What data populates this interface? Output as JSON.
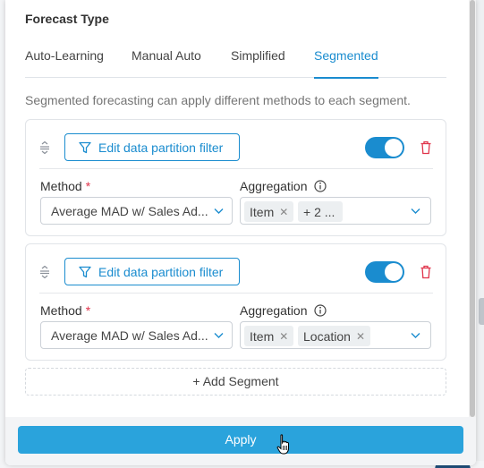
{
  "section_title": "Forecast Type",
  "tabs": [
    {
      "label": "Auto-Learning",
      "active": false
    },
    {
      "label": "Manual Auto",
      "active": false
    },
    {
      "label": "Simplified",
      "active": false
    },
    {
      "label": "Segmented",
      "active": true
    }
  ],
  "description": "Segmented forecasting can apply different methods to each segment.",
  "segments": [
    {
      "filter_label": "Edit data partition filter",
      "enabled": true,
      "method_label": "Method",
      "required_mark": "*",
      "method_value": "Average MAD w/ Sales Ad...",
      "aggregation_label": "Aggregation",
      "aggregation_chips": [
        "Item",
        "+ 2 ..."
      ]
    },
    {
      "filter_label": "Edit data partition filter",
      "enabled": true,
      "method_label": "Method",
      "required_mark": "*",
      "method_value": "Average MAD w/ Sales Ad...",
      "aggregation_label": "Aggregation",
      "aggregation_chips": [
        "Item",
        "Location"
      ]
    }
  ],
  "add_segment_label": "+ Add Segment",
  "apply_label": "Apply",
  "colors": {
    "accent": "#1a8ccf",
    "apply": "#2aa3dc",
    "required": "#e0344b"
  },
  "icons": [
    "filter-icon",
    "drag-handle-icon",
    "trash-icon",
    "info-icon",
    "chevron-down-icon",
    "close-icon",
    "pointer-cursor-icon"
  ]
}
